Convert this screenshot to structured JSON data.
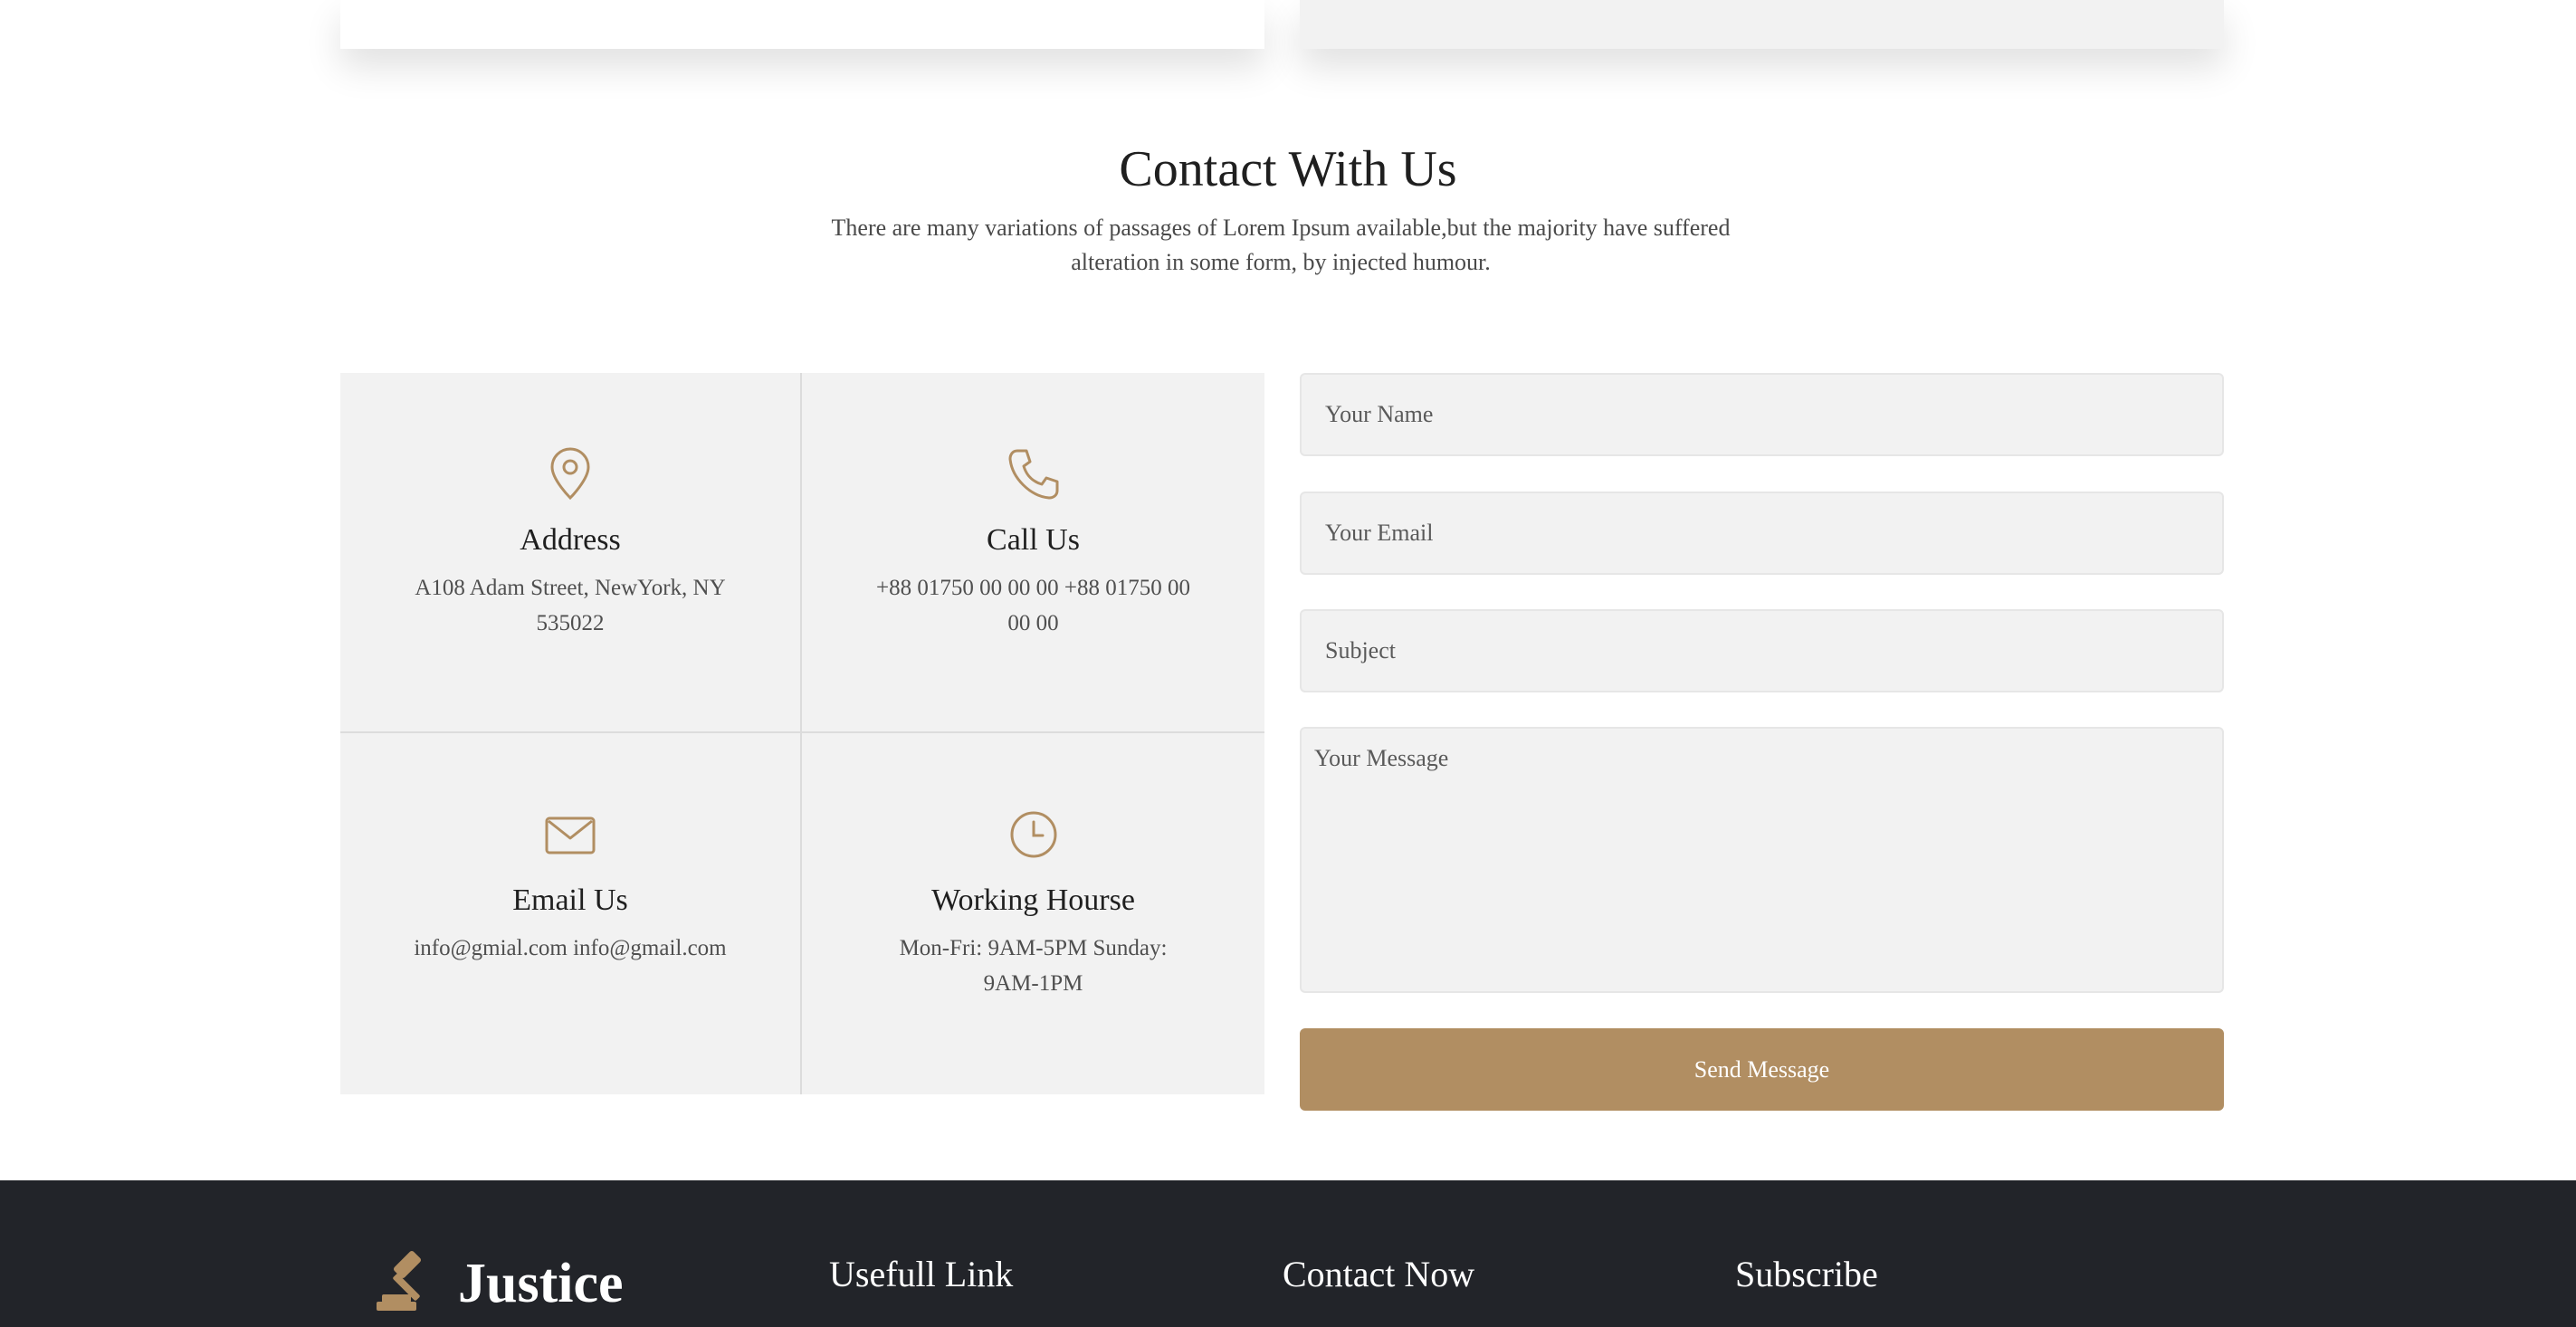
{
  "contact": {
    "title": "Contact With Us",
    "subtitle": "There are many variations of passages of Lorem Ipsum available,but the majority have suffered alteration in some form, by injected humour."
  },
  "info": [
    {
      "icon": "map-pin-icon",
      "title": "Address",
      "text": "A108 Adam Street, NewYork, NY 535022"
    },
    {
      "icon": "phone-icon",
      "title": "Call Us",
      "text": "+88 01750 00 00 00 +88 01750 00 00 00"
    },
    {
      "icon": "mail-icon",
      "title": "Email Us",
      "text": "info@gmial.com info@gmail.com"
    },
    {
      "icon": "clock-icon",
      "title": "Working Hourse",
      "text": "Mon-Fri: 9AM-5PM Sunday: 9AM-1PM"
    }
  ],
  "form": {
    "name_placeholder": "Your Name",
    "email_placeholder": "Your Email",
    "subject_placeholder": "Subject",
    "message_placeholder": "Your Message",
    "submit_label": "Send Message"
  },
  "footer": {
    "logo_text": "Justice",
    "logo_icon": "gavel-icon",
    "useful_links_heading": "Usefull Link",
    "contact_heading": "Contact Now",
    "subscribe_heading": "Subscribe"
  },
  "colors": {
    "accent": "#b18e62",
    "footer_bg": "#222429",
    "card_bg": "#f2f2f2"
  }
}
